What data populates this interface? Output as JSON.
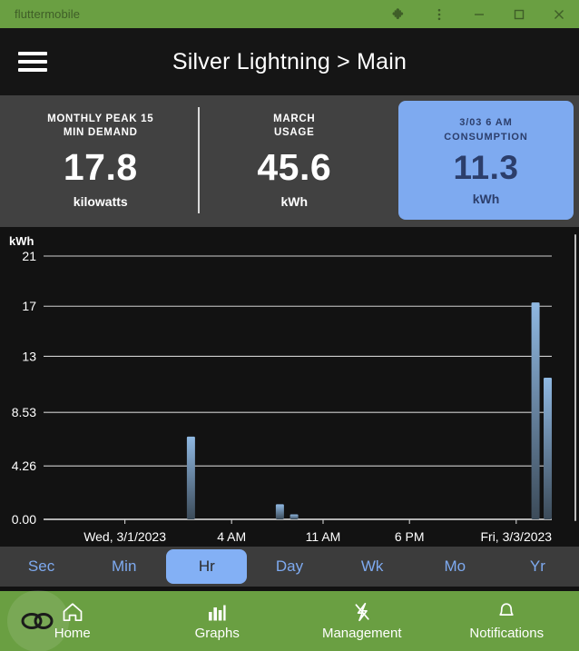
{
  "window": {
    "title": "fluttermobile",
    "controls": {
      "extension": "puzzle-piece-icon",
      "menu": "more-vertical-icon",
      "minimize": "minimize-icon",
      "maximize": "maximize-icon",
      "close": "close-icon"
    },
    "chrome_color": "#6a9f42",
    "chrome_icon_color": "#3f5e28"
  },
  "appbar": {
    "menu_icon": "hamburger-menu-icon",
    "title": "Silver Lightning > Main"
  },
  "stats": {
    "accent_color": "#7eaaf0",
    "panel_color": "#414141",
    "cards": [
      {
        "label_line1": "MONTHLY PEAK 15",
        "label_line2": "MIN DEMAND",
        "value": "17.8",
        "unit": "kilowatts",
        "highlighted": false
      },
      {
        "label_line1": "MARCH",
        "label_line2": "USAGE",
        "value": "45.6",
        "unit": "kWh",
        "highlighted": false
      },
      {
        "label_line1": "3/03 6 AM",
        "label_line2": "CONSUMPTION",
        "value": "11.3",
        "unit": "kWh",
        "highlighted": true
      }
    ]
  },
  "chart_data": {
    "type": "bar",
    "title": "",
    "xlabel": "",
    "ylabel": "kWh",
    "ylim": [
      0,
      21
    ],
    "grid": true,
    "legend": null,
    "ytick_labels": [
      "21",
      "17",
      "13",
      "8.53",
      "4.26",
      "0.00"
    ],
    "ytick_values": [
      21,
      17,
      13,
      8.53,
      4.26,
      0.0
    ],
    "xtick_labels": [
      "Wed, 3/1/2023",
      "4 AM",
      "11 AM",
      "6 PM",
      "Fri, 3/3/2023"
    ],
    "xtick_positions": [
      0.16,
      0.37,
      0.55,
      0.72,
      0.93
    ],
    "bar_color_top": "#8fb8e2",
    "bar_color_bottom": "#3c4b59",
    "series": [
      {
        "name": "Consumption",
        "points": [
          {
            "x": 0.29,
            "value": 6.6
          },
          {
            "x": 0.465,
            "value": 1.2
          },
          {
            "x": 0.493,
            "value": 0.4
          },
          {
            "x": 0.968,
            "value": 17.3
          },
          {
            "x": 0.992,
            "value": 11.3
          }
        ]
      }
    ]
  },
  "ranges": {
    "selected": "Hr",
    "items": [
      {
        "label": "Sec"
      },
      {
        "label": "Min"
      },
      {
        "label": "Hr"
      },
      {
        "label": "Day"
      },
      {
        "label": "Wk"
      },
      {
        "label": "Mo"
      },
      {
        "label": "Yr"
      }
    ]
  },
  "bottomnav": {
    "background": "#6a9f42",
    "items": [
      {
        "label": "Home",
        "icon": "home-icon"
      },
      {
        "label": "Graphs",
        "icon": "bar-chart-icon"
      },
      {
        "label": "Management",
        "icon": "lightning-bolt-icon"
      },
      {
        "label": "Notifications",
        "icon": "bell-icon"
      }
    ]
  },
  "overlay": {
    "cursor_badge": "link-cursor-icon"
  }
}
